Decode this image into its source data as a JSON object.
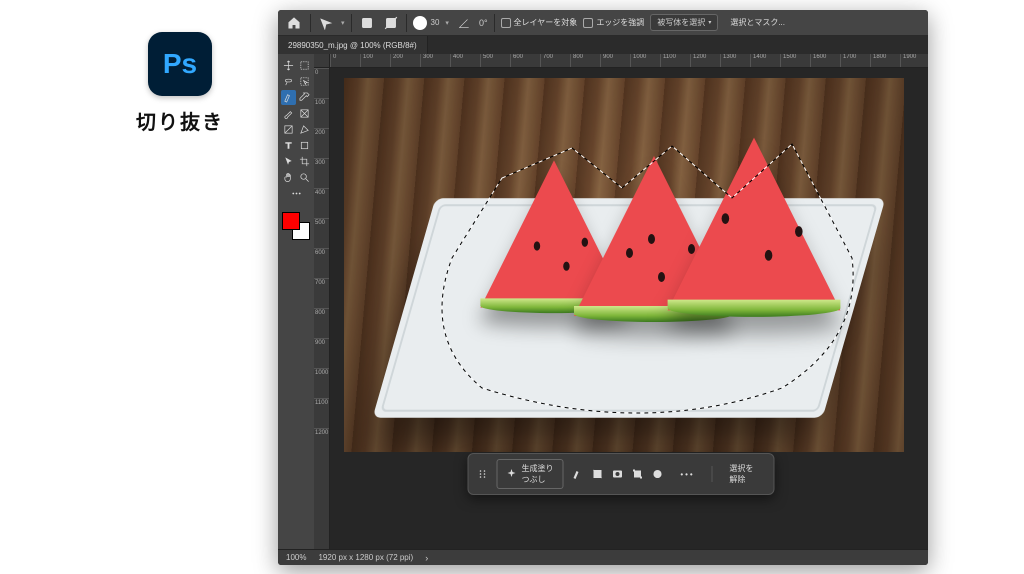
{
  "intro": {
    "badge_text": "Ps",
    "label": "切り抜き"
  },
  "options_bar": {
    "brush_size": "30",
    "angle": "0°",
    "cb_all_layers": "全レイヤーを対象",
    "cb_enhance_edge": "エッジを強調",
    "select_subject": "被写体を選択",
    "select_and_mask": "選択とマスク..."
  },
  "tab": {
    "label": "29890350_m.jpg @ 100% (RGB/8#)"
  },
  "ruler": {
    "h_ticks": [
      "0",
      "100",
      "200",
      "300",
      "400",
      "500",
      "600",
      "700",
      "800",
      "900",
      "1000",
      "1100",
      "1200",
      "1300",
      "1400",
      "1500",
      "1600",
      "1700",
      "1800",
      "1900"
    ],
    "v_ticks": [
      "0",
      "100",
      "200",
      "300",
      "400",
      "500",
      "600",
      "700",
      "800",
      "900",
      "1000",
      "1100",
      "1200"
    ]
  },
  "swatches": {
    "fg": "#ff0000",
    "bg": "#ffffff"
  },
  "action_bar": {
    "generate_fill": "生成塗りつぶし",
    "deselect": "選択を解除",
    "more": "•••"
  },
  "status": {
    "zoom": "100%",
    "doc_info": "1920 px x 1280 px (72 ppi)"
  }
}
